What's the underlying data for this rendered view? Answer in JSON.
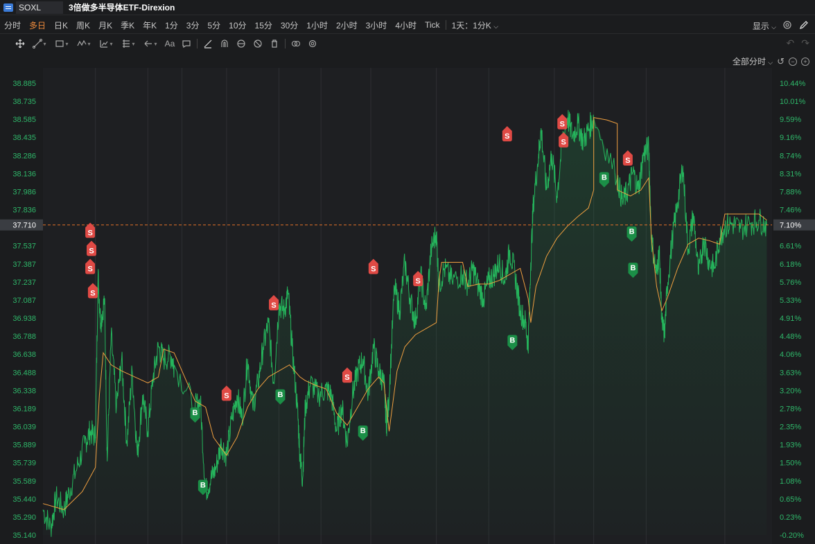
{
  "titlebar": {
    "symbol": "SOXL",
    "title": "3倍做多半导体ETF-Direxion"
  },
  "periods": [
    "分时",
    "多日",
    "日K",
    "周K",
    "月K",
    "季K",
    "年K",
    "1分",
    "3分",
    "5分",
    "10分",
    "15分",
    "30分",
    "1小时",
    "2小时",
    "3小时",
    "4小时",
    "Tick"
  ],
  "active_period": "多日",
  "period_setting": "1天：1分K",
  "display_label": "显示",
  "view_label": "全部分时",
  "current_price": {
    "price": "37.710",
    "pct": "7.10%",
    "value": 37.71
  },
  "colors": {
    "up": "#2fb86a",
    "down": "#e5413f",
    "avg_line": "#f0a040",
    "price_line": "#25b55c",
    "current_line": "#e0702a",
    "buy_marker": "#1b8f47",
    "sell_marker": "#e04a45"
  },
  "chart_data": {
    "type": "line",
    "title": "",
    "days": 12,
    "y_left_ticks": [
      "38.885",
      "38.735",
      "38.585",
      "38.435",
      "38.286",
      "38.136",
      "37.986",
      "37.836",
      "37.710",
      "37.537",
      "37.387",
      "37.237",
      "37.087",
      "36.938",
      "36.788",
      "36.638",
      "36.488",
      "36.338",
      "36.189",
      "36.039",
      "35.889",
      "35.739",
      "35.589",
      "35.440",
      "35.290",
      "35.140"
    ],
    "y_right_ticks": [
      "10.44%",
      "10.01%",
      "9.59%",
      "9.16%",
      "8.74%",
      "8.31%",
      "7.88%",
      "7.46%",
      "7.10%",
      "6.61%",
      "6.18%",
      "5.76%",
      "5.33%",
      "4.91%",
      "4.48%",
      "4.06%",
      "3.63%",
      "3.20%",
      "2.78%",
      "2.35%",
      "1.93%",
      "1.50%",
      "1.08%",
      "0.65%",
      "0.23%",
      "-0.20%"
    ],
    "ylim": [
      35.14,
      38.885
    ],
    "price_series": [
      [
        0.0,
        35.35
      ],
      [
        0.3,
        35.2
      ],
      [
        0.5,
        35.45
      ],
      [
        0.8,
        35.35
      ],
      [
        1.0,
        35.5
      ],
      [
        1.3,
        35.7
      ],
      [
        1.6,
        35.9
      ],
      [
        1.8,
        36.0
      ],
      [
        2.0,
        35.95
      ],
      [
        2.1,
        37.3
      ],
      [
        2.2,
        36.9
      ],
      [
        2.35,
        37.1
      ],
      [
        2.45,
        35.75
      ],
      [
        2.6,
        36.8
      ],
      [
        2.8,
        36.2
      ],
      [
        3.0,
        36.6
      ],
      [
        3.2,
        35.9
      ],
      [
        3.4,
        36.5
      ],
      [
        3.6,
        35.8
      ],
      [
        3.8,
        36.3
      ],
      [
        4.0,
        36.0
      ],
      [
        4.2,
        36.45
      ],
      [
        4.4,
        36.7
      ],
      [
        4.6,
        36.6
      ],
      [
        4.9,
        36.62
      ],
      [
        5.0,
        36.55
      ],
      [
        5.8,
        36.2
      ],
      [
        6.0,
        36.25
      ],
      [
        6.2,
        35.5
      ],
      [
        6.4,
        35.6
      ],
      [
        6.6,
        35.7
      ],
      [
        6.8,
        35.9
      ],
      [
        7.0,
        35.8
      ],
      [
        7.2,
        36.1
      ],
      [
        7.4,
        36.3
      ],
      [
        7.6,
        36.1
      ],
      [
        7.8,
        36.6
      ],
      [
        8.0,
        36.2
      ],
      [
        8.2,
        36.4
      ],
      [
        8.4,
        36.7
      ],
      [
        8.6,
        36.9
      ],
      [
        8.8,
        36.4
      ],
      [
        9.0,
        37.05
      ],
      [
        9.2,
        37.0
      ],
      [
        9.35,
        37.15
      ],
      [
        9.5,
        36.7
      ],
      [
        9.7,
        36.2
      ],
      [
        9.8,
        35.8
      ],
      [
        9.9,
        35.6
      ],
      [
        10.0,
        36.2
      ],
      [
        10.2,
        36.4
      ],
      [
        10.5,
        36.3
      ],
      [
        10.8,
        36.35
      ],
      [
        11.0,
        36.3
      ],
      [
        11.2,
        36.0
      ],
      [
        11.4,
        36.2
      ],
      [
        11.6,
        35.9
      ],
      [
        11.8,
        36.3
      ],
      [
        12.0,
        36.5
      ],
      [
        12.2,
        36.6
      ],
      [
        12.4,
        36.3
      ],
      [
        12.6,
        36.7
      ],
      [
        12.8,
        36.5
      ],
      [
        13.0,
        36.4
      ],
      [
        13.1,
        36.05
      ],
      [
        13.2,
        36.3
      ],
      [
        13.4,
        37.2
      ],
      [
        13.6,
        37.0
      ],
      [
        13.8,
        37.4
      ],
      [
        14.0,
        37.1
      ],
      [
        14.2,
        36.9
      ],
      [
        14.4,
        37.3
      ],
      [
        14.6,
        37.0
      ],
      [
        14.8,
        37.5
      ],
      [
        15.0,
        37.65
      ],
      [
        15.1,
        37.2
      ],
      [
        15.3,
        37.35
      ],
      [
        15.6,
        37.25
      ],
      [
        16.0,
        37.3
      ],
      [
        16.2,
        37.22
      ],
      [
        16.4,
        37.35
      ],
      [
        16.6,
        37.2
      ],
      [
        16.8,
        37.1
      ],
      [
        17.0,
        37.25
      ],
      [
        17.2,
        37.3
      ],
      [
        17.4,
        37.4
      ],
      [
        17.6,
        37.25
      ],
      [
        17.8,
        37.5
      ],
      [
        18.0,
        37.3
      ],
      [
        18.2,
        37.0
      ],
      [
        18.4,
        36.9
      ],
      [
        18.5,
        36.7
      ],
      [
        18.6,
        37.4
      ],
      [
        18.7,
        37.9
      ],
      [
        18.9,
        38.3
      ],
      [
        19.0,
        38.5
      ],
      [
        19.2,
        38.0
      ],
      [
        19.4,
        38.3
      ],
      [
        19.6,
        37.95
      ],
      [
        19.8,
        38.4
      ],
      [
        20.0,
        38.6
      ],
      [
        20.2,
        38.45
      ],
      [
        20.4,
        38.55
      ],
      [
        20.6,
        38.4
      ],
      [
        20.8,
        38.5
      ],
      [
        21.0,
        38.6
      ],
      [
        21.9,
        38.1
      ],
      [
        22.1,
        37.9
      ],
      [
        22.3,
        38.0
      ],
      [
        22.5,
        38.15
      ],
      [
        22.7,
        38.0
      ],
      [
        22.9,
        38.3
      ],
      [
        23.1,
        38.35
      ],
      [
        23.2,
        37.6
      ],
      [
        23.4,
        37.3
      ],
      [
        23.5,
        37.5
      ],
      [
        23.6,
        36.9
      ],
      [
        23.7,
        36.8
      ],
      [
        23.8,
        37.2
      ],
      [
        24.0,
        37.6
      ],
      [
        24.2,
        37.9
      ],
      [
        24.4,
        38.2
      ],
      [
        24.6,
        37.5
      ],
      [
        24.8,
        37.8
      ],
      [
        25.0,
        37.3
      ],
      [
        25.2,
        37.6
      ],
      [
        25.4,
        37.4
      ],
      [
        25.6,
        37.35
      ],
      [
        25.8,
        37.6
      ],
      [
        26.0,
        37.7
      ],
      [
        26.3,
        37.72
      ],
      [
        26.6,
        37.68
      ],
      [
        27.0,
        37.73
      ],
      [
        27.3,
        37.75
      ],
      [
        27.6,
        37.71
      ]
    ],
    "avg_series": [
      [
        0.0,
        35.4
      ],
      [
        0.8,
        35.35
      ],
      [
        1.5,
        35.5
      ],
      [
        2.0,
        35.7
      ],
      [
        2.15,
        36.3
      ],
      [
        2.3,
        36.65
      ],
      [
        2.6,
        36.55
      ],
      [
        3.0,
        36.5
      ],
      [
        3.5,
        36.45
      ],
      [
        4.0,
        36.4
      ],
      [
        4.4,
        36.45
      ],
      [
        4.6,
        36.68
      ],
      [
        5.0,
        36.65
      ],
      [
        5.8,
        36.25
      ],
      [
        6.2,
        36.2
      ],
      [
        6.5,
        35.95
      ],
      [
        7.0,
        35.8
      ],
      [
        7.4,
        35.95
      ],
      [
        7.8,
        36.2
      ],
      [
        8.2,
        36.35
      ],
      [
        8.6,
        36.45
      ],
      [
        9.0,
        36.5
      ],
      [
        9.4,
        36.55
      ],
      [
        9.8,
        36.45
      ],
      [
        10.0,
        36.42
      ],
      [
        10.4,
        36.38
      ],
      [
        10.8,
        36.35
      ],
      [
        11.2,
        36.15
      ],
      [
        11.6,
        36.05
      ],
      [
        12.0,
        36.2
      ],
      [
        12.4,
        36.35
      ],
      [
        12.8,
        36.45
      ],
      [
        13.0,
        36.4
      ],
      [
        13.2,
        36.0
      ],
      [
        13.5,
        36.5
      ],
      [
        13.8,
        36.7
      ],
      [
        14.2,
        36.8
      ],
      [
        14.6,
        36.85
      ],
      [
        15.0,
        36.9
      ],
      [
        15.1,
        37.25
      ],
      [
        15.2,
        37.4
      ],
      [
        15.6,
        37.4
      ],
      [
        16.0,
        37.4
      ],
      [
        16.2,
        37.2
      ],
      [
        16.6,
        37.22
      ],
      [
        17.0,
        37.22
      ],
      [
        17.4,
        37.25
      ],
      [
        17.8,
        37.3
      ],
      [
        18.2,
        37.35
      ],
      [
        18.5,
        37.1
      ],
      [
        18.6,
        36.9
      ],
      [
        18.8,
        37.2
      ],
      [
        19.2,
        37.45
      ],
      [
        19.6,
        37.6
      ],
      [
        20.0,
        37.7
      ],
      [
        20.4,
        37.78
      ],
      [
        20.8,
        37.85
      ],
      [
        21.0,
        38.0
      ],
      [
        21.0,
        38.6
      ],
      [
        21.5,
        38.58
      ],
      [
        21.9,
        38.55
      ],
      [
        21.9,
        38.0
      ],
      [
        22.4,
        37.95
      ],
      [
        22.8,
        38.0
      ],
      [
        23.1,
        38.1
      ],
      [
        23.2,
        37.6
      ],
      [
        23.4,
        37.2
      ],
      [
        23.6,
        37.0
      ],
      [
        23.8,
        37.1
      ],
      [
        24.2,
        37.35
      ],
      [
        24.6,
        37.55
      ],
      [
        25.0,
        37.6
      ],
      [
        25.4,
        37.58
      ],
      [
        25.8,
        37.55
      ],
      [
        26.0,
        37.8
      ],
      [
        27.3,
        37.8
      ],
      [
        27.6,
        37.75
      ]
    ],
    "day_boundaries": [
      2.0,
      4.0,
      5.3,
      7.0,
      9.0,
      10.6,
      12.5,
      15.0,
      17.0,
      19.5,
      21.0,
      23.0,
      26.0
    ],
    "x_max": 27.8,
    "trade_markers": [
      {
        "type": "S",
        "x": 1.8,
        "y": 37.7
      },
      {
        "type": "S",
        "x": 1.85,
        "y": 37.55
      },
      {
        "type": "S",
        "x": 1.8,
        "y": 37.4
      },
      {
        "type": "S",
        "x": 1.9,
        "y": 37.2
      },
      {
        "type": "B",
        "x": 5.8,
        "y": 36.1
      },
      {
        "type": "B",
        "x": 6.1,
        "y": 35.5
      },
      {
        "type": "S",
        "x": 7.0,
        "y": 36.35
      },
      {
        "type": "S",
        "x": 8.8,
        "y": 37.1
      },
      {
        "type": "B",
        "x": 9.05,
        "y": 36.25
      },
      {
        "type": "S",
        "x": 11.6,
        "y": 36.5
      },
      {
        "type": "B",
        "x": 12.2,
        "y": 35.95
      },
      {
        "type": "S",
        "x": 12.6,
        "y": 37.4
      },
      {
        "type": "S",
        "x": 14.3,
        "y": 37.3
      },
      {
        "type": "B",
        "x": 17.9,
        "y": 36.7
      },
      {
        "type": "S",
        "x": 17.7,
        "y": 38.5
      },
      {
        "type": "S",
        "x": 19.8,
        "y": 38.6
      },
      {
        "type": "S",
        "x": 19.85,
        "y": 38.45
      },
      {
        "type": "B",
        "x": 21.4,
        "y": 38.05
      },
      {
        "type": "S",
        "x": 22.3,
        "y": 38.3
      },
      {
        "type": "B",
        "x": 22.45,
        "y": 37.6
      },
      {
        "type": "B",
        "x": 22.5,
        "y": 37.3
      }
    ]
  }
}
